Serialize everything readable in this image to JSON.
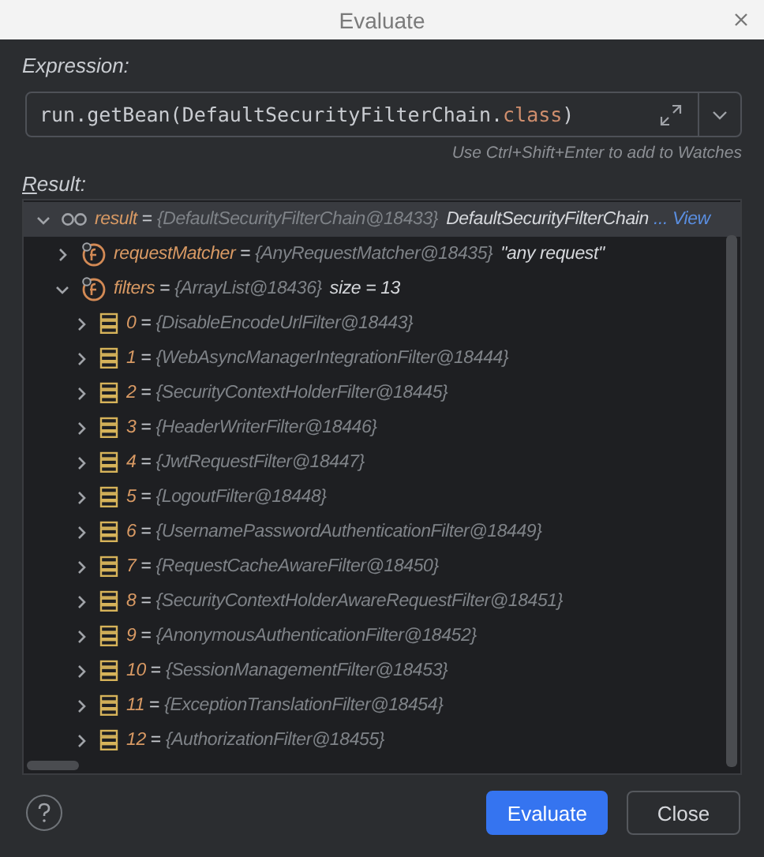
{
  "window": {
    "title": "Evaluate"
  },
  "expression": {
    "label": "Expression:",
    "parts": [
      {
        "text": "run.getBean(",
        "kind": "plain"
      },
      {
        "text": "DefaultSecurityFilterChain.",
        "kind": "plain"
      },
      {
        "text": "class",
        "kind": "keyword"
      },
      {
        "text": ")",
        "kind": "plain"
      }
    ],
    "hint": "Use Ctrl+Shift+Enter to add to Watches"
  },
  "result": {
    "label": "Result:",
    "tree": [
      {
        "name": "result",
        "sep": "=",
        "kind": "object",
        "value": "{DefaultSecurityFilterChain@18433}",
        "extra": "DefaultSecurityFilterChain",
        "link": "... View",
        "expanded": true,
        "selected": true,
        "children": [
          {
            "name": "requestMatcher",
            "sep": "=",
            "kind": "field",
            "value": "{AnyRequestMatcher@18435}",
            "extra": "\"any request\"",
            "expanded": false,
            "selected": false
          },
          {
            "name": "filters",
            "sep": "=",
            "kind": "field",
            "value": "{ArrayList@18436}",
            "extra": "size = 13",
            "expanded": true,
            "selected": false,
            "children": [
              {
                "name": "0",
                "sep": "=",
                "kind": "element",
                "value": "{DisableEncodeUrlFilter@18443}",
                "expanded": false,
                "selected": false
              },
              {
                "name": "1",
                "sep": "=",
                "kind": "element",
                "value": "{WebAsyncManagerIntegrationFilter@18444}",
                "expanded": false,
                "selected": false
              },
              {
                "name": "2",
                "sep": "=",
                "kind": "element",
                "value": "{SecurityContextHolderFilter@18445}",
                "expanded": false,
                "selected": false
              },
              {
                "name": "3",
                "sep": "=",
                "kind": "element",
                "value": "{HeaderWriterFilter@18446}",
                "expanded": false,
                "selected": false
              },
              {
                "name": "4",
                "sep": "=",
                "kind": "element",
                "value": "{JwtRequestFilter@18447}",
                "expanded": false,
                "selected": false
              },
              {
                "name": "5",
                "sep": "=",
                "kind": "element",
                "value": "{LogoutFilter@18448}",
                "expanded": false,
                "selected": false
              },
              {
                "name": "6",
                "sep": "=",
                "kind": "element",
                "value": "{UsernamePasswordAuthenticationFilter@18449}",
                "expanded": false,
                "selected": false
              },
              {
                "name": "7",
                "sep": "=",
                "kind": "element",
                "value": "{RequestCacheAwareFilter@18450}",
                "expanded": false,
                "selected": false
              },
              {
                "name": "8",
                "sep": "=",
                "kind": "element",
                "value": "{SecurityContextHolderAwareRequestFilter@18451}",
                "expanded": false,
                "selected": false
              },
              {
                "name": "9",
                "sep": "=",
                "kind": "element",
                "value": "{AnonymousAuthenticationFilter@18452}",
                "expanded": false,
                "selected": false
              },
              {
                "name": "10",
                "sep": "=",
                "kind": "element",
                "value": "{SessionManagementFilter@18453}",
                "expanded": false,
                "selected": false
              },
              {
                "name": "11",
                "sep": "=",
                "kind": "element",
                "value": "{ExceptionTranslationFilter@18454}",
                "expanded": false,
                "selected": false
              },
              {
                "name": "12",
                "sep": "=",
                "kind": "element",
                "value": "{AuthorizationFilter@18455}",
                "expanded": false,
                "selected": false
              }
            ]
          }
        ]
      }
    ]
  },
  "buttons": [
    {
      "label": "Evaluate",
      "kind": "primary"
    },
    {
      "label": "Close",
      "kind": "secondary"
    }
  ]
}
